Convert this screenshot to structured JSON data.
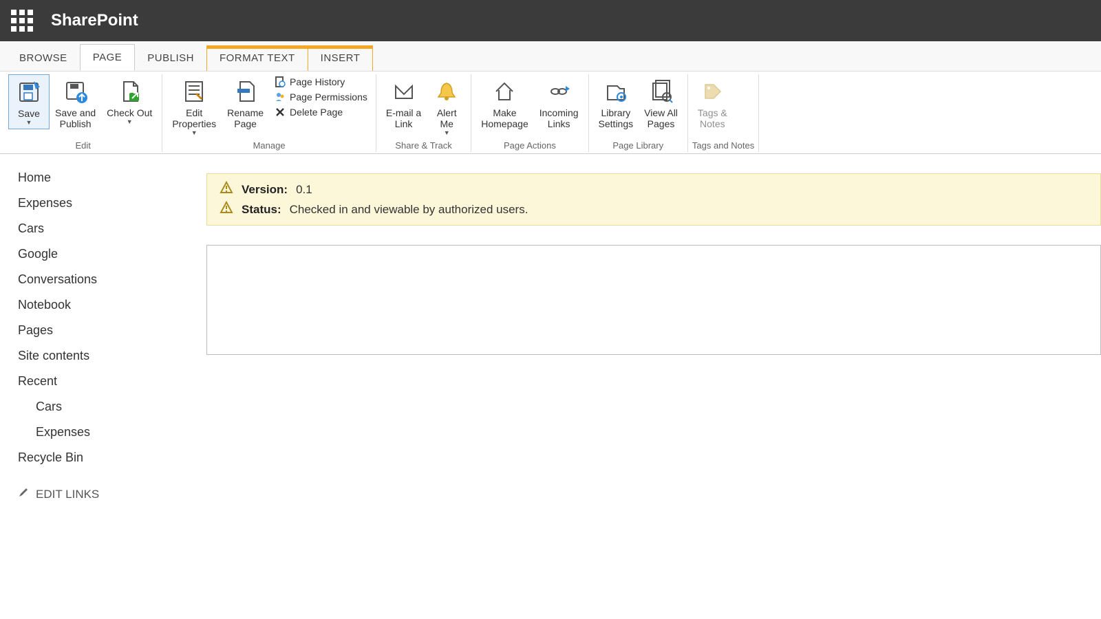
{
  "header": {
    "brand": "SharePoint"
  },
  "tabs": {
    "browse": "BROWSE",
    "page": "PAGE",
    "publish": "PUBLISH",
    "format_text": "FORMAT TEXT",
    "insert": "INSERT"
  },
  "ribbon": {
    "edit": {
      "label": "Edit",
      "save": "Save",
      "save_publish": "Save and\nPublish",
      "check_out": "Check Out"
    },
    "manage": {
      "label": "Manage",
      "edit_properties": "Edit\nProperties",
      "rename_page": "Rename\nPage",
      "page_history": "Page History",
      "page_permissions": "Page Permissions",
      "delete_page": "Delete Page"
    },
    "share_track": {
      "label": "Share & Track",
      "email_link": "E-mail a\nLink",
      "alert_me": "Alert\nMe"
    },
    "page_actions": {
      "label": "Page Actions",
      "make_homepage": "Make\nHomepage",
      "incoming_links": "Incoming\nLinks"
    },
    "page_library": {
      "label": "Page Library",
      "library_settings": "Library\nSettings",
      "view_all_pages": "View All\nPages"
    },
    "tags_notes": {
      "label": "Tags and Notes",
      "tags_notes": "Tags &\nNotes"
    }
  },
  "sidebar": {
    "items": [
      "Home",
      "Expenses",
      "Cars",
      "Google",
      "Conversations",
      "Notebook",
      "Pages",
      "Site contents",
      "Recent"
    ],
    "recent_children": [
      "Cars",
      "Expenses"
    ],
    "recycle": "Recycle Bin",
    "edit_links": "EDIT LINKS"
  },
  "status": {
    "version_label": "Version:",
    "version_value": "0.1",
    "status_label": "Status:",
    "status_value": "Checked in and viewable by authorized users."
  }
}
